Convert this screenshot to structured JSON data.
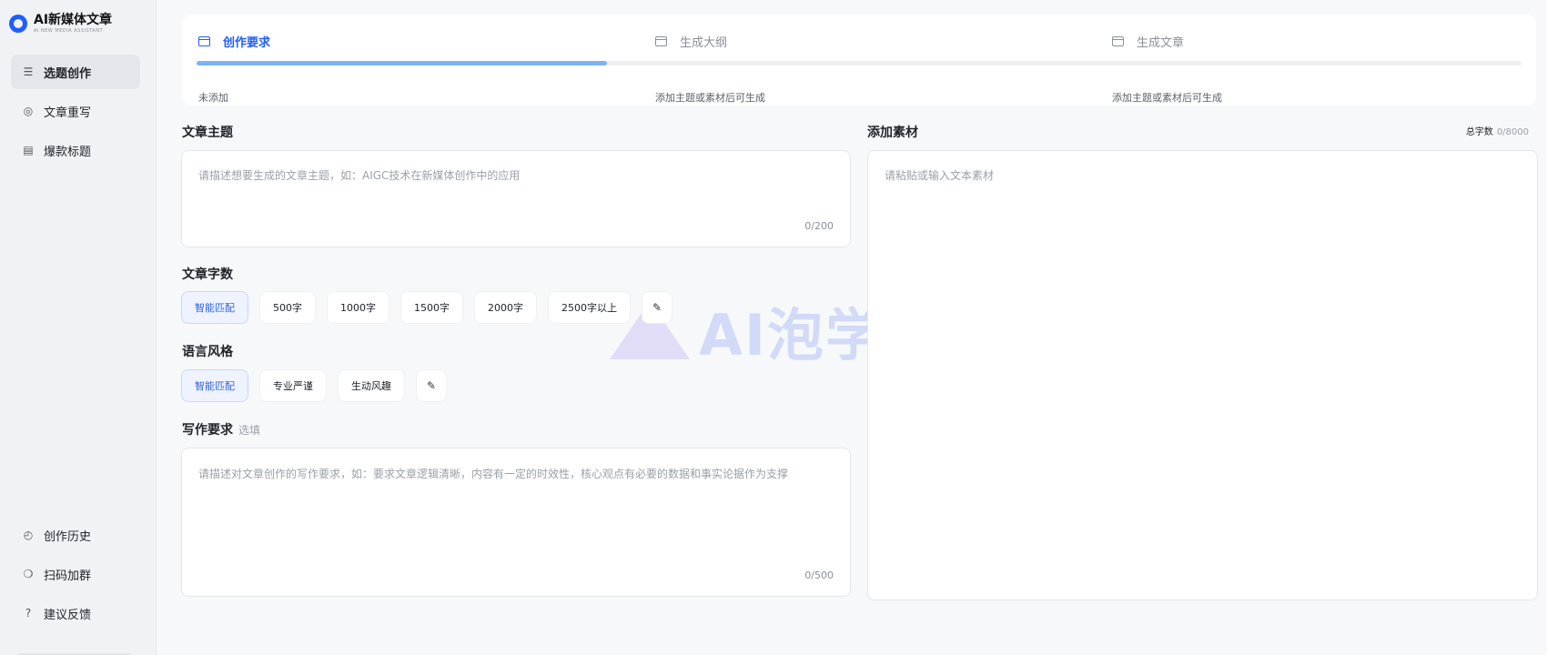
{
  "app": {
    "title": "AI新媒体文章",
    "subtitle": "AI NEW MEDIA ASSISTANT"
  },
  "sidebar": {
    "items": [
      {
        "label": "选题创作",
        "icon": "list-icon",
        "active": true
      },
      {
        "label": "文章重写",
        "icon": "rewrite-icon",
        "active": false
      },
      {
        "label": "爆款标题",
        "icon": "document-icon",
        "active": false
      }
    ],
    "bottom_items": [
      {
        "label": "创作历史",
        "icon": "clock-icon"
      },
      {
        "label": "扫码加群",
        "icon": "wechat-icon"
      },
      {
        "label": "建议反馈",
        "icon": "help-icon"
      }
    ]
  },
  "steps": {
    "items": [
      {
        "label": "创作要求",
        "note": "未添加",
        "active": true
      },
      {
        "label": "生成大纲",
        "note": "添加主题或素材后可生成",
        "active": false
      },
      {
        "label": "生成文章",
        "note": "添加主题或素材后可生成",
        "active": false
      }
    ],
    "progress": 0.31
  },
  "topic": {
    "title": "文章主题",
    "placeholder": "请描述想要生成的文章主题，如：AIGC技术在新媒体创作中的应用",
    "counter": "0/200"
  },
  "word_count": {
    "title": "文章字数",
    "options": [
      "智能匹配",
      "500字",
      "1000字",
      "1500字",
      "2000字",
      "2500字以上"
    ],
    "selected": "智能匹配"
  },
  "style": {
    "title": "语言风格",
    "options": [
      "智能匹配",
      "专业严谨",
      "生动风趣"
    ],
    "selected": "智能匹配"
  },
  "requirements": {
    "title": "写作要求",
    "optional_label": "选填",
    "placeholder": "请描述对文章创作的写作要求，如：要求文章逻辑清晰，内容有一定的时效性，核心观点有必要的数据和事实论据作为支撑",
    "counter": "0/500"
  },
  "material": {
    "title": "添加素材",
    "total_label": "总字数",
    "total_value": "0/8000",
    "placeholder": "请粘贴或输入文本素材"
  },
  "watermark": {
    "text": "AI泡学堂"
  },
  "colors": {
    "accent": "#1e5eff",
    "selected_bg": "#eef3ff"
  }
}
